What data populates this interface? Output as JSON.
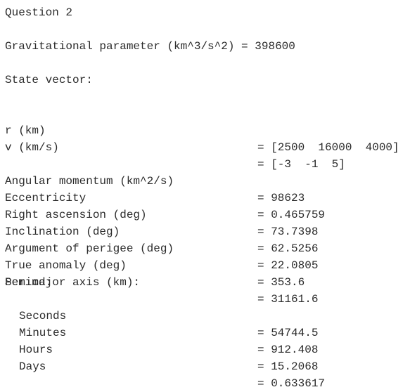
{
  "heading": "Question 2",
  "gravitational_parameter": "Gravitational parameter (km^3/s^2) = 398600",
  "state_vector_title": "State vector:",
  "state_vector": [
    {
      "label": "r (km)",
      "value": "= [2500  16000  4000]"
    },
    {
      "label": "v (km/s)",
      "value": "= [-3  -1  5]"
    }
  ],
  "elements": [
    {
      "label": "Angular momentum (km^2/s)",
      "value": "= 98623"
    },
    {
      "label": "Eccentricity",
      "value": "= 0.465759"
    },
    {
      "label": "Right ascension (deg)",
      "value": "= 73.7398"
    },
    {
      "label": "Inclination (deg)",
      "value": "= 62.5256"
    },
    {
      "label": "Argument of perigee (deg)",
      "value": "= 22.0805"
    },
    {
      "label": "True anomaly (deg)",
      "value": "= 353.6"
    },
    {
      "label": "Semimajor axis (km):",
      "value": "= 31161.6"
    }
  ],
  "period_title": "Period:",
  "period": [
    {
      "label": "Seconds",
      "value": "= 54744.5"
    },
    {
      "label": "Minutes",
      "value": "= 912.408"
    },
    {
      "label": "Hours",
      "value": "= 15.2068"
    },
    {
      "label": "Days",
      "value": "= 0.633617"
    }
  ]
}
